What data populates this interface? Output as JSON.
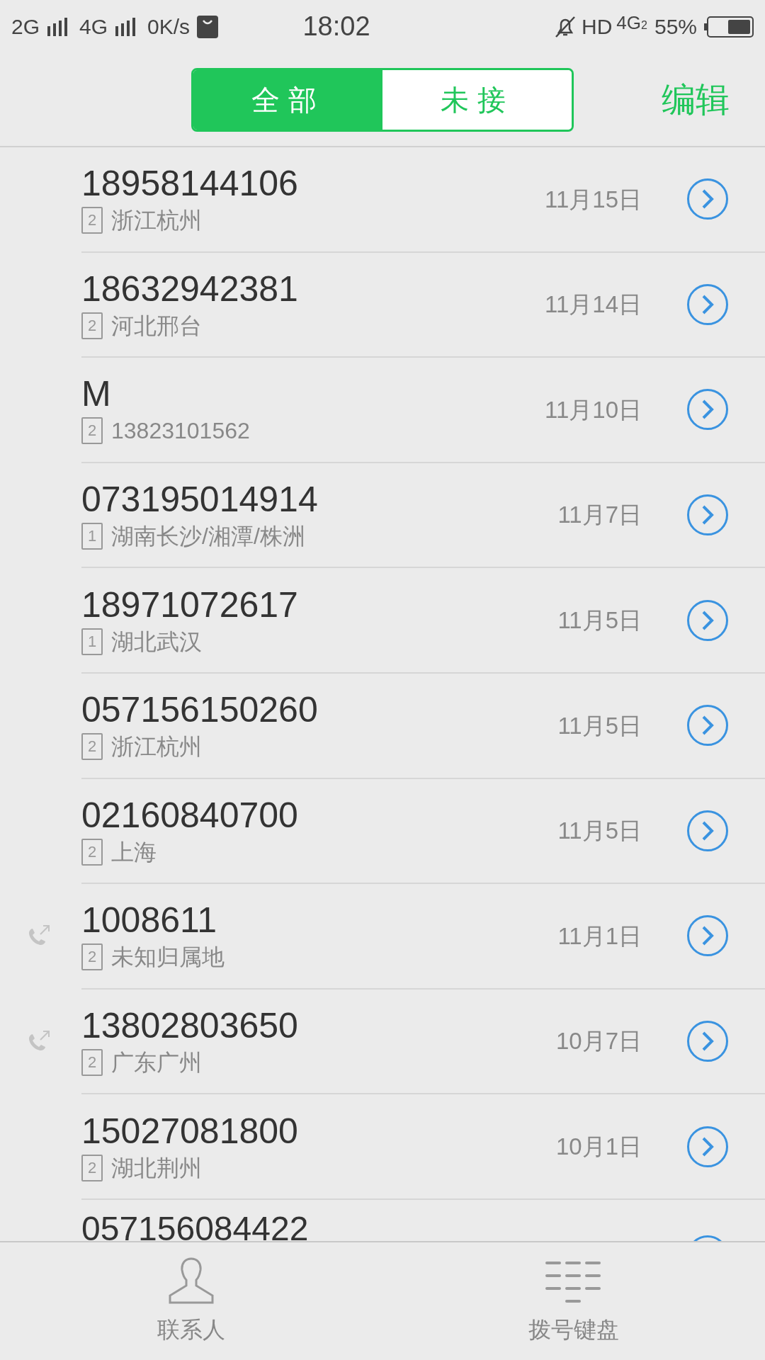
{
  "status_bar": {
    "sim1": "2G",
    "sim2": "4G",
    "speed": "0K/s",
    "time": "18:02",
    "hd": "HD",
    "network": "4G",
    "network_sim": "2",
    "battery": "55%"
  },
  "tabs": [
    {
      "label": "全部",
      "selected": true
    },
    {
      "label": "未接",
      "selected": false
    }
  ],
  "edit": "编辑",
  "calls": [
    {
      "name": "18958144106",
      "sim": "2",
      "location": "浙江杭州",
      "date": "11月15日",
      "outgoing": false
    },
    {
      "name": "18632942381",
      "sim": "2",
      "location": "河北邢台",
      "date": "11月14日",
      "outgoing": false
    },
    {
      "name": "M",
      "sim": "2",
      "location": "13823101562",
      "date": "11月10日",
      "outgoing": false
    },
    {
      "name": "073195014914",
      "sim": "1",
      "location": "湖南长沙/湘潭/株洲",
      "date": "11月7日",
      "outgoing": false
    },
    {
      "name": "18971072617",
      "sim": "1",
      "location": "湖北武汉",
      "date": "11月5日",
      "outgoing": false
    },
    {
      "name": "057156150260",
      "sim": "2",
      "location": "浙江杭州",
      "date": "11月5日",
      "outgoing": false
    },
    {
      "name": "02160840700",
      "sim": "2",
      "location": "上海",
      "date": "11月5日",
      "outgoing": false
    },
    {
      "name": "1008611",
      "sim": "2",
      "location": "未知归属地",
      "date": "11月1日",
      "outgoing": true
    },
    {
      "name": "13802803650",
      "sim": "2",
      "location": "广东广州",
      "date": "10月7日",
      "outgoing": true
    },
    {
      "name": "15027081800",
      "sim": "2",
      "location": "湖北荆州",
      "date": "10月1日",
      "outgoing": false
    }
  ],
  "partial_row": {
    "name": "057156084422"
  },
  "bottom_nav": [
    {
      "label": "联系人",
      "kind": "contacts"
    },
    {
      "label": "拨号键盘",
      "kind": "dialpad"
    }
  ]
}
